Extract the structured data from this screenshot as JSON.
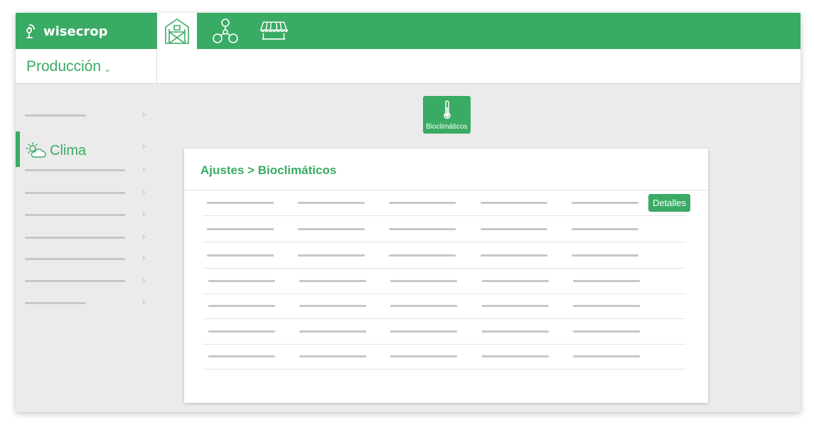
{
  "app": {
    "logo_text": "wisecrop",
    "colors": {
      "brand": "#3aab64",
      "placeholder": "#c7c7c7",
      "background": "#ebebeb"
    }
  },
  "topnav": {
    "items": [
      {
        "icon": "greenhouse-icon",
        "active": true
      },
      {
        "icon": "network-icon",
        "active": false
      },
      {
        "icon": "market-stall-icon",
        "active": false
      }
    ]
  },
  "production": {
    "label": "Producción",
    "chevron": "⌄"
  },
  "sidebar": {
    "active_item": {
      "label": "Clima",
      "icon": "sun-cloud-icon"
    },
    "arrow": "›"
  },
  "module": {
    "label": "Bioclimáticos",
    "icon": "thermometer-icon"
  },
  "card": {
    "breadcrumb": "Ajustes > Bioclimáticos",
    "details_label": "Detalles"
  }
}
